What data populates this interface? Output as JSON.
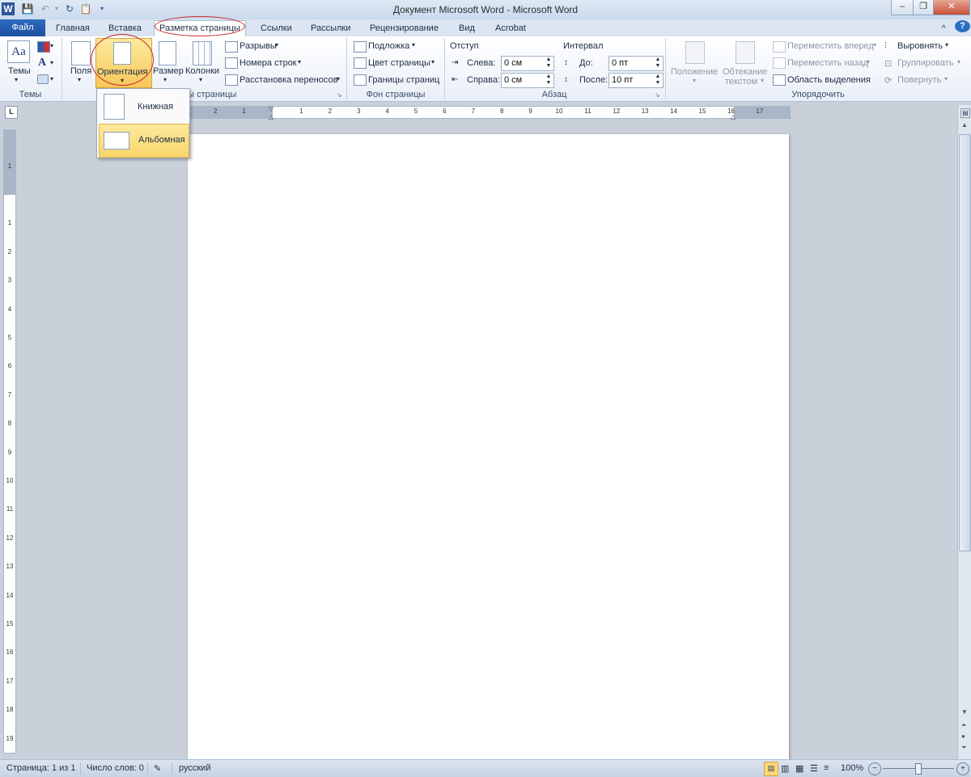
{
  "window": {
    "title": "Документ Microsoft Word - Microsoft Word"
  },
  "tabs": {
    "file": "Файл",
    "home": "Главная",
    "insert": "Вставка",
    "layout": "Разметка страницы",
    "references": "Ссылки",
    "mailings": "Рассылки",
    "review": "Рецензирование",
    "view": "Вид",
    "acrobat": "Acrobat"
  },
  "ribbon": {
    "themes": {
      "themes_label": "Темы",
      "group": "Темы"
    },
    "page_setup": {
      "margins": "Поля",
      "orientation": "Ориентация",
      "size": "Размер",
      "columns": "Колонки",
      "breaks": "Разрывы",
      "line_numbers": "Номера строк",
      "hyphenation": "Расстановка переносов",
      "group": "ры страницы"
    },
    "page_background": {
      "watermark": "Подложка",
      "page_color": "Цвет страницы",
      "page_borders": "Границы страниц",
      "group": "Фон страницы"
    },
    "paragraph": {
      "indent": "Отступ",
      "left": "Слева:",
      "left_value": "0 см",
      "right": "Справа:",
      "right_value": "0 см",
      "spacing": "Интервал",
      "before": "До:",
      "before_value": "0 пт",
      "after": "После:",
      "after_value": "10 пт",
      "group": "Абзац"
    },
    "arrange": {
      "position_1": "Положение",
      "wrap_1": "Обтекание",
      "wrap_2": "текстом",
      "bring_forward": "Переместить вперед",
      "send_backward": "Переместить назад",
      "selection_pane": "Область выделения",
      "align": "Выровнять",
      "group_btn": "Группировать",
      "rotate": "Повернуть",
      "group": "Упорядочить"
    }
  },
  "orientation_menu": {
    "portrait": "Книжная",
    "landscape": "Альбомная"
  },
  "status": {
    "page": "Страница: 1 из 1",
    "words": "Число слов: 0",
    "language": "русский",
    "zoom": "100%"
  },
  "ruler_h_ticks": [
    "2",
    "1",
    "1",
    "2",
    "3",
    "4",
    "5",
    "6",
    "7",
    "8",
    "9",
    "10",
    "11",
    "12",
    "13",
    "14",
    "15",
    "16",
    "17"
  ],
  "ruler_v_ticks": [
    "1",
    "1",
    "2",
    "3",
    "4",
    "5",
    "6",
    "7",
    "8",
    "9",
    "10",
    "11",
    "12",
    "13",
    "14",
    "15",
    "16",
    "17",
    "18",
    "19"
  ],
  "colors": {
    "accent": "#2b579a",
    "highlight": "#f9d66c",
    "annotation": "#c8262b"
  }
}
